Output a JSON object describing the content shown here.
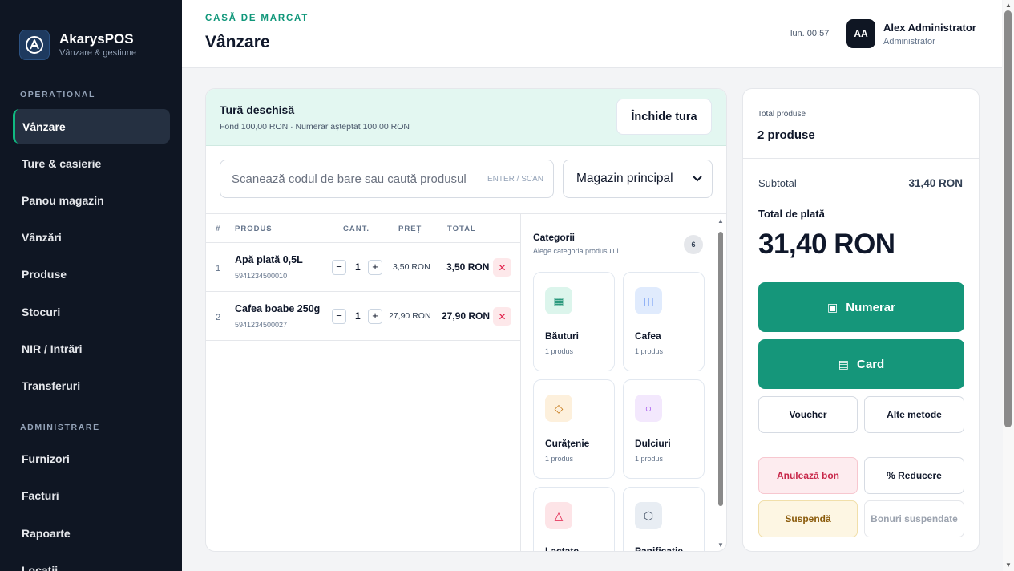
{
  "brand": {
    "name": "AkarysPOS",
    "subtitle": "Vânzare & gestiune"
  },
  "sidebar": {
    "sections": [
      {
        "label": "OPERAȚIONAL"
      },
      {
        "label": "ADMINISTRARE"
      }
    ],
    "items": [
      {
        "label": "Vânzare",
        "active": true
      },
      {
        "label": "Ture & casierie"
      },
      {
        "label": "Panou magazin"
      },
      {
        "label": "Vânzări"
      },
      {
        "label": "Produse"
      },
      {
        "label": "Stocuri"
      },
      {
        "label": "NIR / Intrări"
      },
      {
        "label": "Transferuri"
      },
      {
        "label": "Furnizori"
      },
      {
        "label": "Facturi"
      },
      {
        "label": "Rapoarte"
      },
      {
        "label": "Locații"
      }
    ]
  },
  "header": {
    "kicker": "CASĂ DE MARCAT",
    "title": "Vânzare",
    "time": "lun. 00:57",
    "user_initials": "AA",
    "user_name": "Alex Administrator",
    "user_role": "Administrator"
  },
  "shift": {
    "title": "Tură deschisă",
    "subtitle": "Fond 100,00 RON · Numerar așteptat 100,00 RON",
    "close_label": "Închide tura"
  },
  "search": {
    "placeholder": "Scanează codul de bare sau caută produsul",
    "hint": "ENTER / SCAN"
  },
  "location": {
    "selected": "Magazin principal"
  },
  "cart": {
    "columns": {
      "index": "#",
      "product": "PRODUS",
      "qty": "CANT.",
      "price": "PREȚ",
      "total": "TOTAL"
    },
    "rows": [
      {
        "index": "1",
        "name": "Apă plată 0,5L",
        "code": "5941234500010",
        "qty": "1",
        "price": "3,50 RON",
        "total": "3,50 RON"
      },
      {
        "index": "2",
        "name": "Cafea boabe 250g",
        "code": "5941234500027",
        "qty": "1",
        "price": "27,90 RON",
        "total": "27,90 RON"
      }
    ]
  },
  "categories": {
    "title": "Categorii",
    "subtitle": "Alege categoria produsului",
    "count": "6",
    "items": [
      {
        "name": "Băuturi",
        "count": "1 produs",
        "icon": "grid-icon",
        "glyph": "▦",
        "bg": "#dcf5ec",
        "fg": "#0f8a6b"
      },
      {
        "name": "Cafea",
        "count": "1 produs",
        "icon": "columns-icon",
        "glyph": "◫",
        "bg": "#e0ebfd",
        "fg": "#2563eb"
      },
      {
        "name": "Curățenie",
        "count": "1 produs",
        "icon": "diamond-icon",
        "glyph": "◇",
        "bg": "#fdf0dc",
        "fg": "#c2710c"
      },
      {
        "name": "Dulciuri",
        "count": "1 produs",
        "icon": "circle-icon",
        "glyph": "○",
        "bg": "#f3e8fd",
        "fg": "#9333ea"
      },
      {
        "name": "Lactate",
        "count": "",
        "icon": "triangle-icon",
        "glyph": "△",
        "bg": "#fde4e7",
        "fg": "#e11d48"
      },
      {
        "name": "Panificație",
        "count": "",
        "icon": "hexagon-icon",
        "glyph": "⬡",
        "bg": "#e8edf3",
        "fg": "#475569"
      }
    ]
  },
  "summary": {
    "products_label": "Total produse",
    "products_count": "2 produse",
    "subtotal_label": "Subtotal",
    "subtotal_value": "31,40 RON",
    "total_label": "Total de plată",
    "total_value": "31,40 RON",
    "cash_label": "Numerar",
    "card_label": "Card",
    "voucher_label": "Voucher",
    "other_label": "Alte metode",
    "cancel_label": "Anulează bon",
    "discount_label": "% Reducere",
    "suspend_label": "Suspendă",
    "suspended_label": "Bonuri suspendate"
  },
  "colors": {
    "accent": "#15967a",
    "sidebar_bg": "#0f1623",
    "danger": "#e11d48"
  }
}
